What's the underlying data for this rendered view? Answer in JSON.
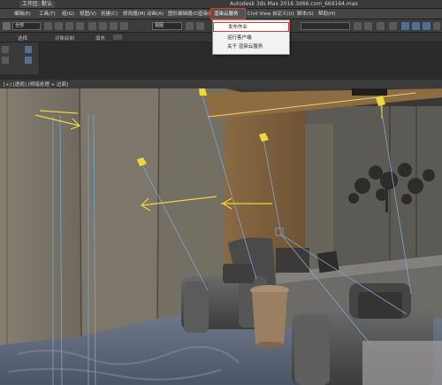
{
  "app": {
    "title": "Autodesk 3ds Max 2016   3d66.com_669164.max",
    "workspace": "工作区: 默认"
  },
  "menubar": {
    "items": [
      "编辑(E)",
      "工具(T)",
      "组(G)",
      "视图(V)",
      "创建(C)",
      "修改器(M)",
      "动画(A)",
      "图形编辑器(D)",
      "渲染(R)",
      "渲染云服务",
      "Civil View",
      "自定义(U)",
      "脚本(S)",
      "帮助(H)"
    ],
    "highlighted": "渲染云服务"
  },
  "toolbar": {
    "selection_filter": "全部",
    "view_dropdown": "视图"
  },
  "ribbon": {
    "labels": [
      "选择",
      "对象绘制",
      "填充"
    ]
  },
  "viewport": {
    "label": "[+] [透视] [明暗处理 + 边面]"
  },
  "dropdown": {
    "items": [
      "发布作业",
      "运行客户端",
      "关于 渲染云服务"
    ],
    "highlighted_index": 0
  },
  "colors": {
    "highlight_border": "#e3382f",
    "light_gizmo": "#f0d63a",
    "target_line": "#7fa6cc"
  }
}
